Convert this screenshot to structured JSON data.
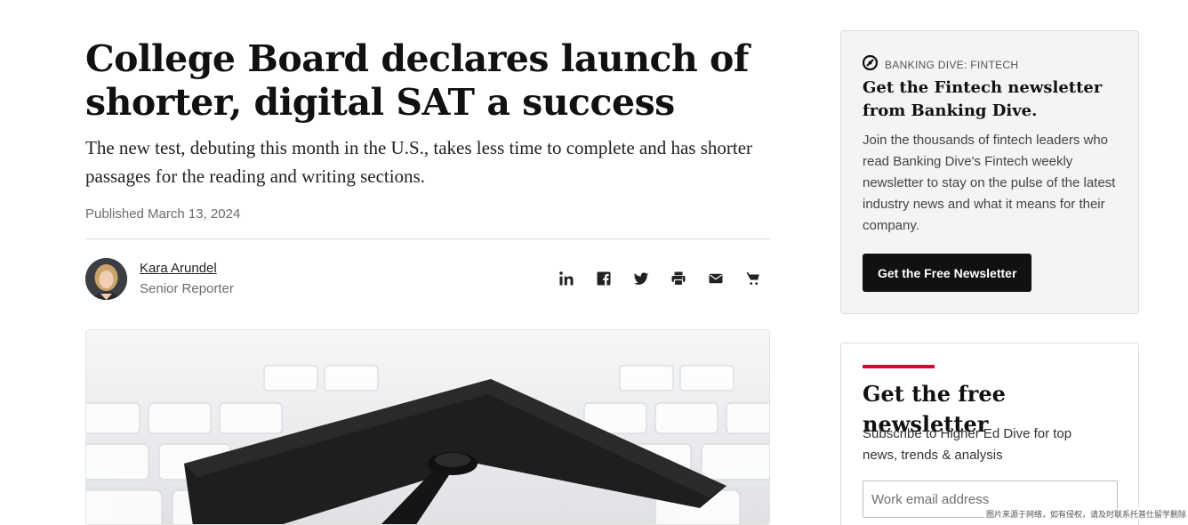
{
  "article": {
    "headline": "College Board declares launch of shorter, digital SAT a success",
    "dek": "The new test, debuting this month in the U.S., takes less time to complete and has shorter passages for the reading and writing sections.",
    "published": "Published March 13, 2024",
    "author": {
      "name": "Kara Arundel",
      "title": "Senior Reporter"
    },
    "share_icons": [
      "linkedin-icon",
      "facebook-icon",
      "twitter-icon",
      "print-icon",
      "email-icon",
      "cart-icon"
    ],
    "hero_image": "graduation-cap-on-keyboard"
  },
  "promo": {
    "kicker": "BANKING DIVE: FINTECH",
    "title": "Get the Fintech newsletter from Banking Dive.",
    "body": "Join the thousands of fintech leaders who read Banking Dive's Fintech weekly newsletter to stay on the pulse of the latest industry news and what it means for their company.",
    "button_label": "Get the Free Newsletter"
  },
  "signup": {
    "title": "Get the free newsletter",
    "body": "Subscribe to Higher Ed Dive for top news, trends & analysis",
    "email_placeholder": "Work email address"
  },
  "watermark": "图片来源于网络，如有侵权，请及时联系托普仕留学删除",
  "colors": {
    "accent": "#c8102e",
    "button_bg": "#111111",
    "promo_bg": "#f4f4f6"
  }
}
